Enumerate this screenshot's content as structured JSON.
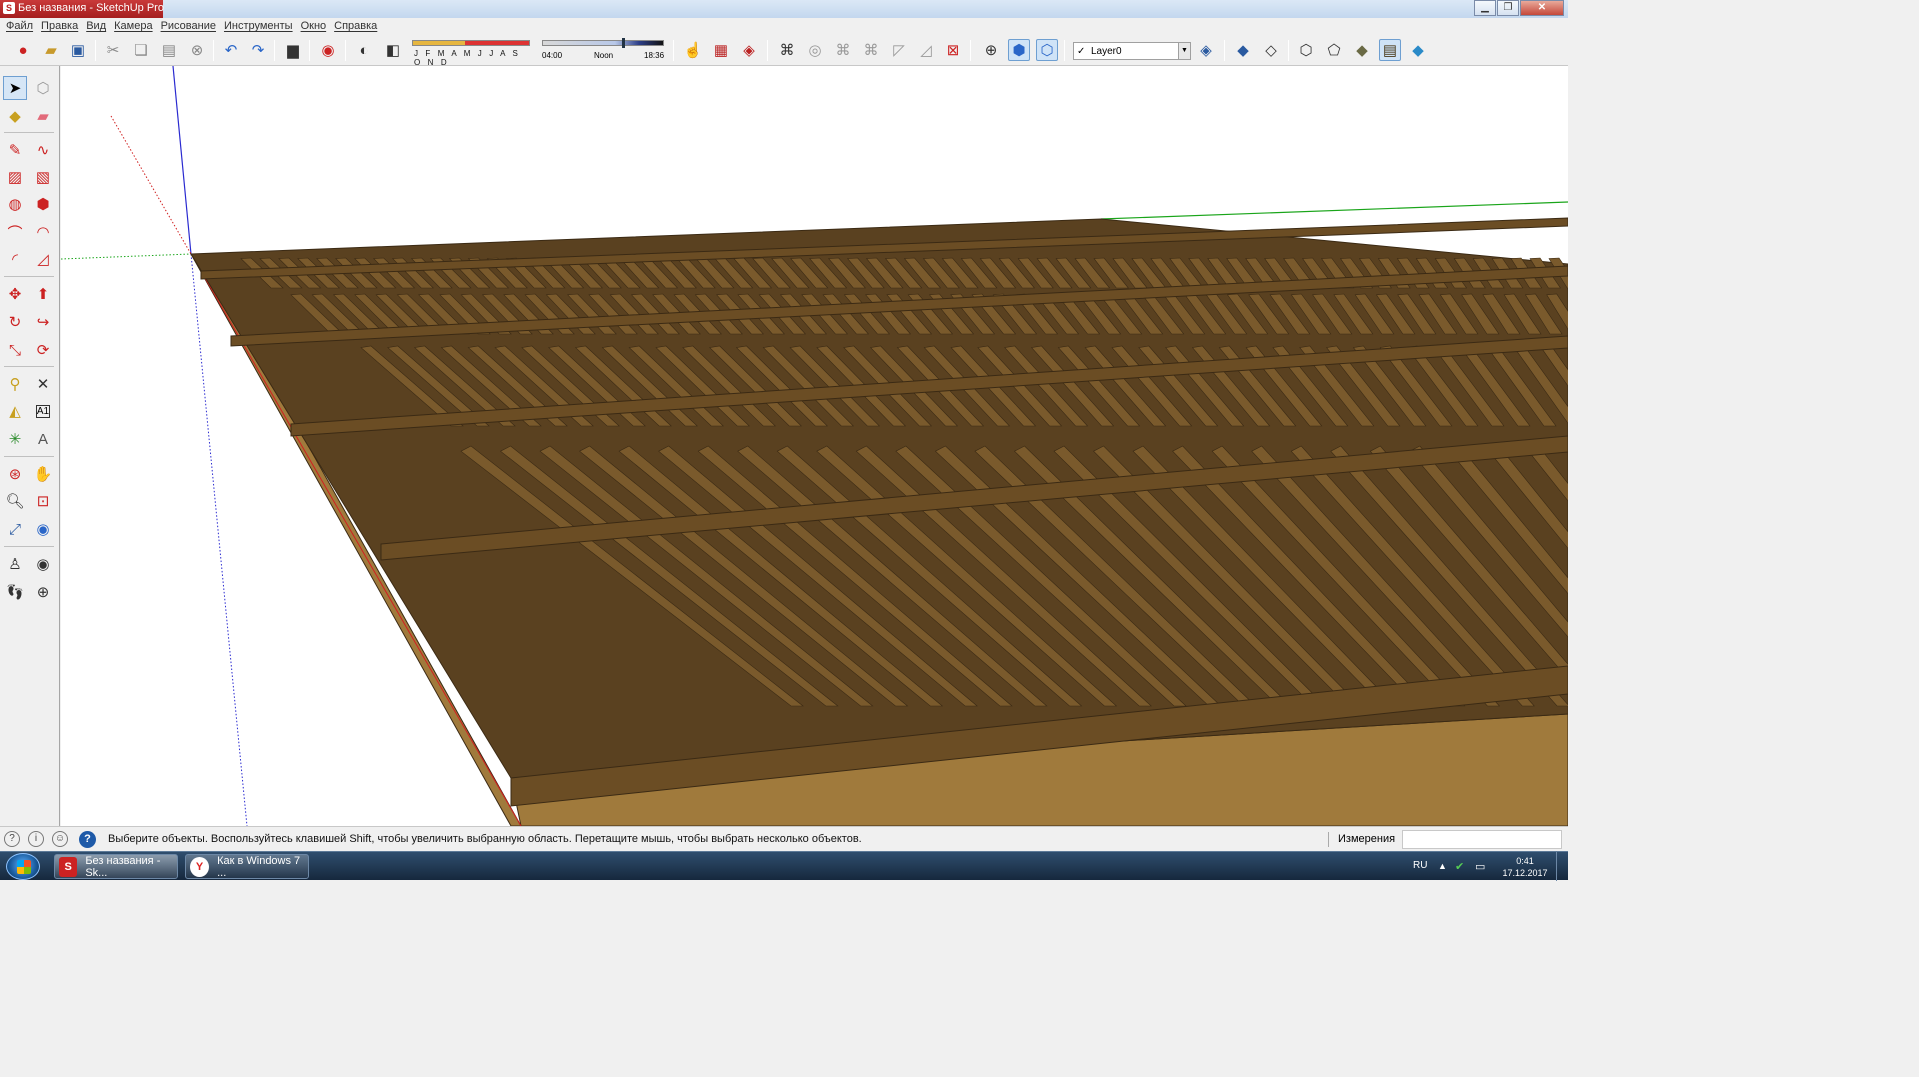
{
  "window": {
    "title": "Без названия - SketchUp Pro",
    "app_icon": "sketchup-logo-icon",
    "controls": [
      "minimize-icon",
      "maximize-icon",
      "close-icon"
    ]
  },
  "menu": {
    "items": [
      {
        "label": "Файл"
      },
      {
        "label": "Правка"
      },
      {
        "label": "Вид"
      },
      {
        "label": "Камера"
      },
      {
        "label": "Рисование"
      },
      {
        "label": "Инструменты"
      },
      {
        "label": "Окно"
      },
      {
        "label": "Справка"
      }
    ]
  },
  "toolbar": {
    "shadow_months": "J F M A M J J A S O N D",
    "time_start": "04:00",
    "time_mid": "Noon",
    "time_end": "18:36",
    "layer_name": "Layer0",
    "layer_checked": true
  },
  "statusbar": {
    "hint": "Выберите объекты. Воспользуйтесь клавишей Shift, чтобы увеличить выбранную область. Перетащите мышь, чтобы выбрать несколько объектов.",
    "measurements_label": "Измерения",
    "measurements_value": ""
  },
  "taskbar": {
    "tasks": [
      {
        "label": "Без названия - Sk...",
        "icon": "sketchup-icon",
        "active": true
      },
      {
        "label": "Как в Windows 7 ...",
        "icon": "yandex-browser-icon",
        "active": false
      }
    ],
    "language": "RU",
    "time": "0:41",
    "date": "17.12.2017"
  },
  "colors": {
    "model_top": "#5a4120",
    "model_slat": "#7a5a2c",
    "model_edge": "#3b2a14",
    "model_side": "#a07a3c",
    "axis_red": "#d02020",
    "axis_green": "#1aa51a",
    "axis_blue": "#2a2ad0",
    "title_accent": "#b52a2a"
  }
}
